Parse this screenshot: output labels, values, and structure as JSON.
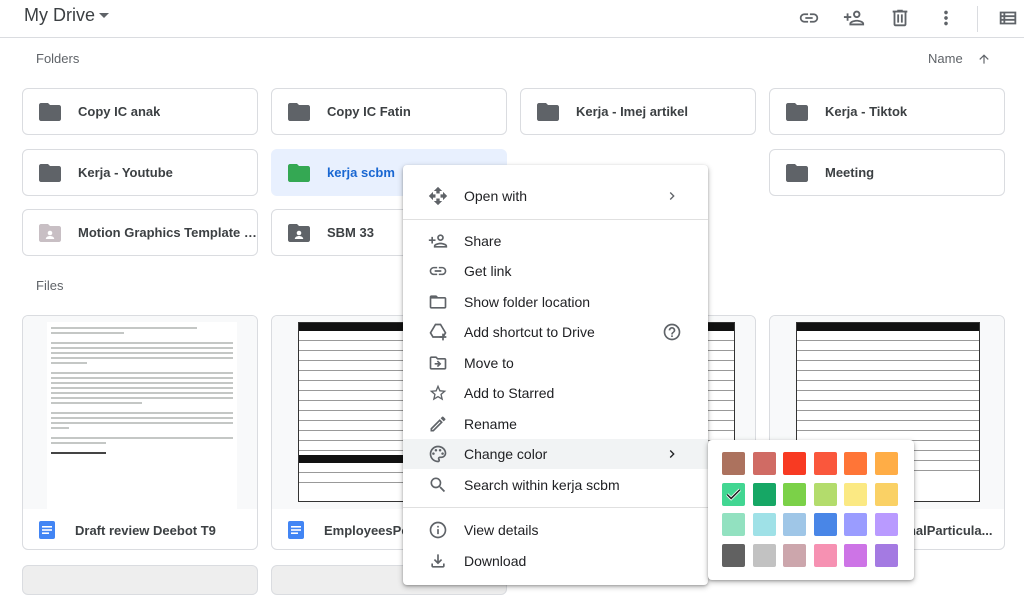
{
  "header": {
    "title": "My Drive",
    "icons": [
      "link-icon",
      "add-person-icon",
      "trash-icon",
      "more-vert-icon",
      "list-view-icon"
    ]
  },
  "folders_section": {
    "label": "Folders",
    "sort_label": "Name"
  },
  "folders": [
    {
      "name": "Copy IC anak",
      "color": "#5f6368",
      "shared": false
    },
    {
      "name": "Copy IC Fatin",
      "color": "#5f6368",
      "shared": false
    },
    {
      "name": "Kerja - Imej artikel",
      "color": "#5f6368",
      "shared": false
    },
    {
      "name": "Kerja - Tiktok",
      "color": "#5f6368",
      "shared": false
    },
    {
      "name": "Kerja - Youtube",
      "color": "#5f6368",
      "shared": false
    },
    {
      "name": "kerja scbm",
      "color": "#34a853",
      "shared": false,
      "selected": true
    },
    {
      "name": "Meeting",
      "color": "#5f6368",
      "shared": false
    },
    {
      "name": "Motion Graphics Template M...",
      "color": "#c8bfc4",
      "shared": true
    },
    {
      "name": "SBM 33",
      "color": "#5f6368",
      "shared": true
    }
  ],
  "files_section": {
    "label": "Files"
  },
  "files": [
    {
      "name": "Draft review Deebot T9"
    },
    {
      "name": "EmployeesPer"
    },
    {
      "name": "onalParticula..."
    }
  ],
  "context_menu": {
    "items": [
      {
        "label": "Open with",
        "icon": "open-with-icon",
        "submenu": true
      },
      {
        "label": "Share",
        "icon": "add-person-icon"
      },
      {
        "label": "Get link",
        "icon": "link-icon"
      },
      {
        "label": "Show folder location",
        "icon": "folder-outline-icon"
      },
      {
        "label": "Add shortcut to Drive",
        "icon": "add-shortcut-icon",
        "help": true
      },
      {
        "label": "Move to",
        "icon": "move-to-icon"
      },
      {
        "label": "Add to Starred",
        "icon": "star-outline-icon"
      },
      {
        "label": "Rename",
        "icon": "pencil-icon"
      },
      {
        "label": "Change color",
        "icon": "palette-icon",
        "submenu": true,
        "highlighted": true
      },
      {
        "label": "Search within kerja scbm",
        "icon": "search-icon"
      },
      {
        "label": "View details",
        "icon": "info-icon"
      },
      {
        "label": "Download",
        "icon": "download-icon"
      }
    ]
  },
  "color_palette": {
    "selected_index": 6,
    "colors": [
      "#ac725e",
      "#d06b64",
      "#f83a22",
      "#fa573c",
      "#ff7537",
      "#ffad46",
      "#42d692",
      "#16a765",
      "#7bd148",
      "#b3dc6c",
      "#fbe983",
      "#fad165",
      "#92e1c0",
      "#9fe1e7",
      "#9fc6e7",
      "#4986e7",
      "#9a9cff",
      "#b99aff",
      "#616161",
      "#c2c2c2",
      "#cca6ac",
      "#f691b2",
      "#cd74e6",
      "#a47ae2"
    ]
  }
}
